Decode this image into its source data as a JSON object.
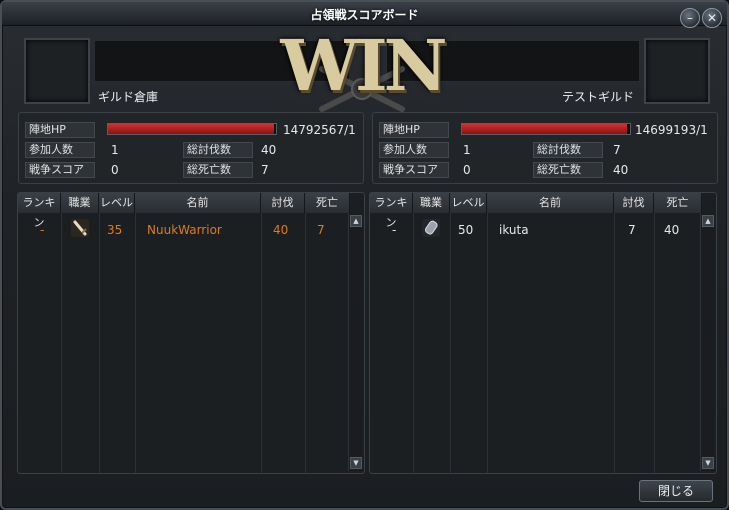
{
  "window": {
    "title": "占領戦スコアボード"
  },
  "banner": {
    "result": "WIN"
  },
  "left": {
    "guild_name": "ギルド倉庫",
    "stats": {
      "hp_label": "陣地HP",
      "hp_value": "14792567/1",
      "hp_fraction": 0.99,
      "members_label": "参加人数",
      "members": "1",
      "kills_label": "総討伐数",
      "kills": "40",
      "score_label": "戦争スコア",
      "score": "0",
      "deaths_label": "総死亡数",
      "deaths": "7"
    },
    "columns": [
      "ランキン",
      "職業",
      "レベル",
      "名前",
      "討伐",
      "死亡"
    ],
    "rows": [
      {
        "rank": "-",
        "job_icon": "sword-icon",
        "level": "35",
        "name": "NuukWarrior",
        "kills": "40",
        "deaths": "7"
      }
    ]
  },
  "right": {
    "guild_name": "テストギルド",
    "stats": {
      "hp_label": "陣地HP",
      "hp_value": "14699193/1",
      "hp_fraction": 0.98,
      "members_label": "参加人数",
      "members": "1",
      "kills_label": "総討伐数",
      "kills": "7",
      "score_label": "戦争スコア",
      "score": "0",
      "deaths_label": "総死亡数",
      "deaths": "40"
    },
    "columns": [
      "ランキン",
      "職業",
      "レベル",
      "名前",
      "討伐",
      "死亡"
    ],
    "rows": [
      {
        "rank": "-",
        "job_icon": "cannon-icon",
        "level": "50",
        "name": "ikuta",
        "kills": "7",
        "deaths": "40"
      }
    ]
  },
  "buttons": {
    "close_label": "閉じる"
  },
  "colors": {
    "accent_orange": "#e07a1c",
    "hp_red": "#c42222"
  }
}
